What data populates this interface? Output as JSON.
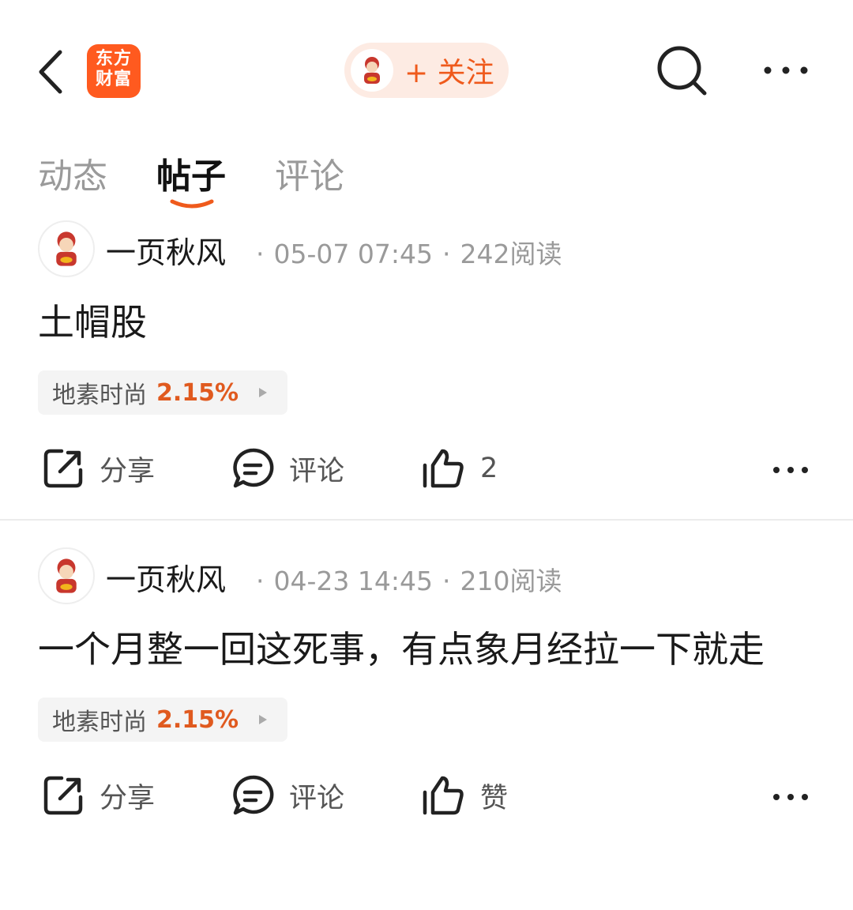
{
  "header": {
    "logo_line1": "东方",
    "logo_line2": "财富",
    "follow_label": "+ 关注",
    "accent_color": "#ef5a1c",
    "icons": [
      "back-icon",
      "search-icon",
      "more-icon"
    ]
  },
  "tabs": [
    {
      "label": "动态",
      "active": false
    },
    {
      "label": "帖子",
      "active": true
    },
    {
      "label": "评论",
      "active": false
    }
  ],
  "posts": [
    {
      "author": "一页秋风",
      "date": "05-07 07:45",
      "reads": "242阅读",
      "text": "土帽股",
      "stock_name": "地素时尚",
      "stock_pct": "2.15%",
      "share_label": "分享",
      "comment_label": "评论",
      "like_label": "2"
    },
    {
      "author": "一页秋风",
      "date": "04-23 14:45",
      "reads": "210阅读",
      "text": "一个月整一回这死事，有点象月经拉一下就走",
      "stock_name": "地素时尚",
      "stock_pct": "2.15%",
      "share_label": "分享",
      "comment_label": "评论",
      "like_label": "赞"
    }
  ]
}
